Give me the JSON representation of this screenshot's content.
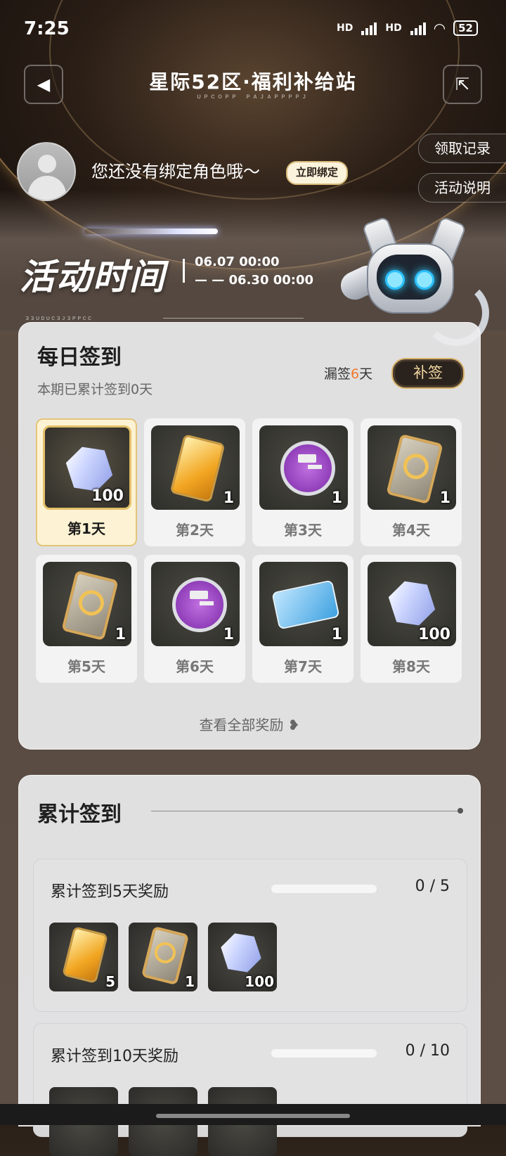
{
  "status_bar": {
    "time": "7:25",
    "network1": "HD",
    "network2": "HD",
    "battery": "52"
  },
  "header": {
    "title": "星际52区·福利补给站",
    "subtitle": "ᴜᴘᴄᴏᴘᴘ ᴘᴀᴊᴀᴘᴘᴘᴘᴊ"
  },
  "profile": {
    "bind_text": "您还没有绑定角色哦～",
    "bind_button": "立即绑定"
  },
  "side_buttons": {
    "records": "领取记录",
    "rules": "活动说明"
  },
  "activity": {
    "title": "活动时间",
    "start": "06.07 00:00",
    "end": "— — 06.30 00:00",
    "deco": "ᴈᴈᴜᴅᴜᴄᴈᴊᴈᴘᴘᴄᴄ"
  },
  "daily": {
    "title": "每日签到",
    "subtitle": "本期已累计签到0天",
    "missed_prefix": "漏签",
    "missed_count": "6",
    "missed_suffix": "天",
    "makeup_button": "补签",
    "view_all": "查看全部奖励 ❥",
    "days": [
      {
        "label": "第1天",
        "qty": "100",
        "item": "gem",
        "active": true
      },
      {
        "label": "第2天",
        "qty": "1",
        "item": "gold-card",
        "active": false
      },
      {
        "label": "第3天",
        "qty": "1",
        "item": "hammer-coin",
        "active": false
      },
      {
        "label": "第4天",
        "qty": "1",
        "item": "ring-card",
        "active": false
      },
      {
        "label": "第5天",
        "qty": "1",
        "item": "ring-card",
        "active": false
      },
      {
        "label": "第6天",
        "qty": "1",
        "item": "hammer-coin",
        "active": false
      },
      {
        "label": "第7天",
        "qty": "1",
        "item": "ticket",
        "active": false
      },
      {
        "label": "第8天",
        "qty": "100",
        "item": "gem",
        "active": false
      }
    ]
  },
  "cumulative": {
    "title": "累计签到",
    "rewards": [
      {
        "title": "累计签到5天奖励",
        "progress": "0 / 5",
        "items": [
          {
            "item": "gold-card",
            "qty": "5"
          },
          {
            "item": "ring-card",
            "qty": "1"
          },
          {
            "item": "gem",
            "qty": "100"
          }
        ]
      },
      {
        "title": "累计签到10天奖励",
        "progress": "0 / 10"
      }
    ]
  },
  "colors": {
    "accent_orange": "#f07a2c",
    "gold": "#d7b46c",
    "dark": "#2a231d"
  }
}
